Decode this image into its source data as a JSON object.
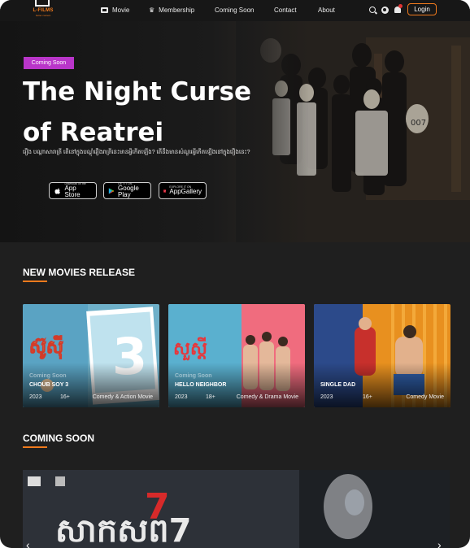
{
  "nav": {
    "logo_text": "L-FILMS",
    "logo_tagline": "better content",
    "items": [
      {
        "label": "Movie",
        "icon": "film-icon"
      },
      {
        "label": "Membership",
        "icon": "crown-icon"
      },
      {
        "label": "Coming Soon"
      },
      {
        "label": "Contact"
      },
      {
        "label": "About"
      }
    ],
    "login_label": "Login"
  },
  "hero": {
    "badge": "Coming Soon",
    "title": "The Night Curse of Reatrei",
    "description": "រឿង បណ្តាសារាត្រី តើនៅក្នុងបណ្តុំរឿងរាត្រីនេះមានអ្វីកើតឡើង? តើនឹងមានសំណួរអ្វីកើតឡើងនៅក្នុងរឿងនេះ?",
    "stores": [
      {
        "small": "Download on the",
        "big": "App Store",
        "icon": "apple-icon"
      },
      {
        "small": "GET IT ON",
        "big": "Google Play",
        "icon": "google-play-icon"
      },
      {
        "small": "EXPLORE IT ON",
        "big": "AppGallery",
        "icon": "huawei-icon"
      }
    ]
  },
  "new_release": {
    "title": "NEW MOVIES RELEASE",
    "movies": [
      {
        "title": "CHOUB SOY 3",
        "year": "2023",
        "age": "16+",
        "genre": "Comedy & Action Movie",
        "soon": "Coming Soon"
      },
      {
        "title": "HELLO NEIGHBOR",
        "year": "2023",
        "age": "18+",
        "genre": "Comedy & Drama Movie",
        "soon": "Coming Soon"
      },
      {
        "title": "SINGLE DAD",
        "year": "2023",
        "age": "16+",
        "genre": "Comedy Movie",
        "soon": ""
      }
    ]
  },
  "coming_soon": {
    "title": "COMING SOON"
  },
  "colors": {
    "accent": "#f07a1d",
    "badge": "#b935c9",
    "background": "#1f1f1f"
  }
}
